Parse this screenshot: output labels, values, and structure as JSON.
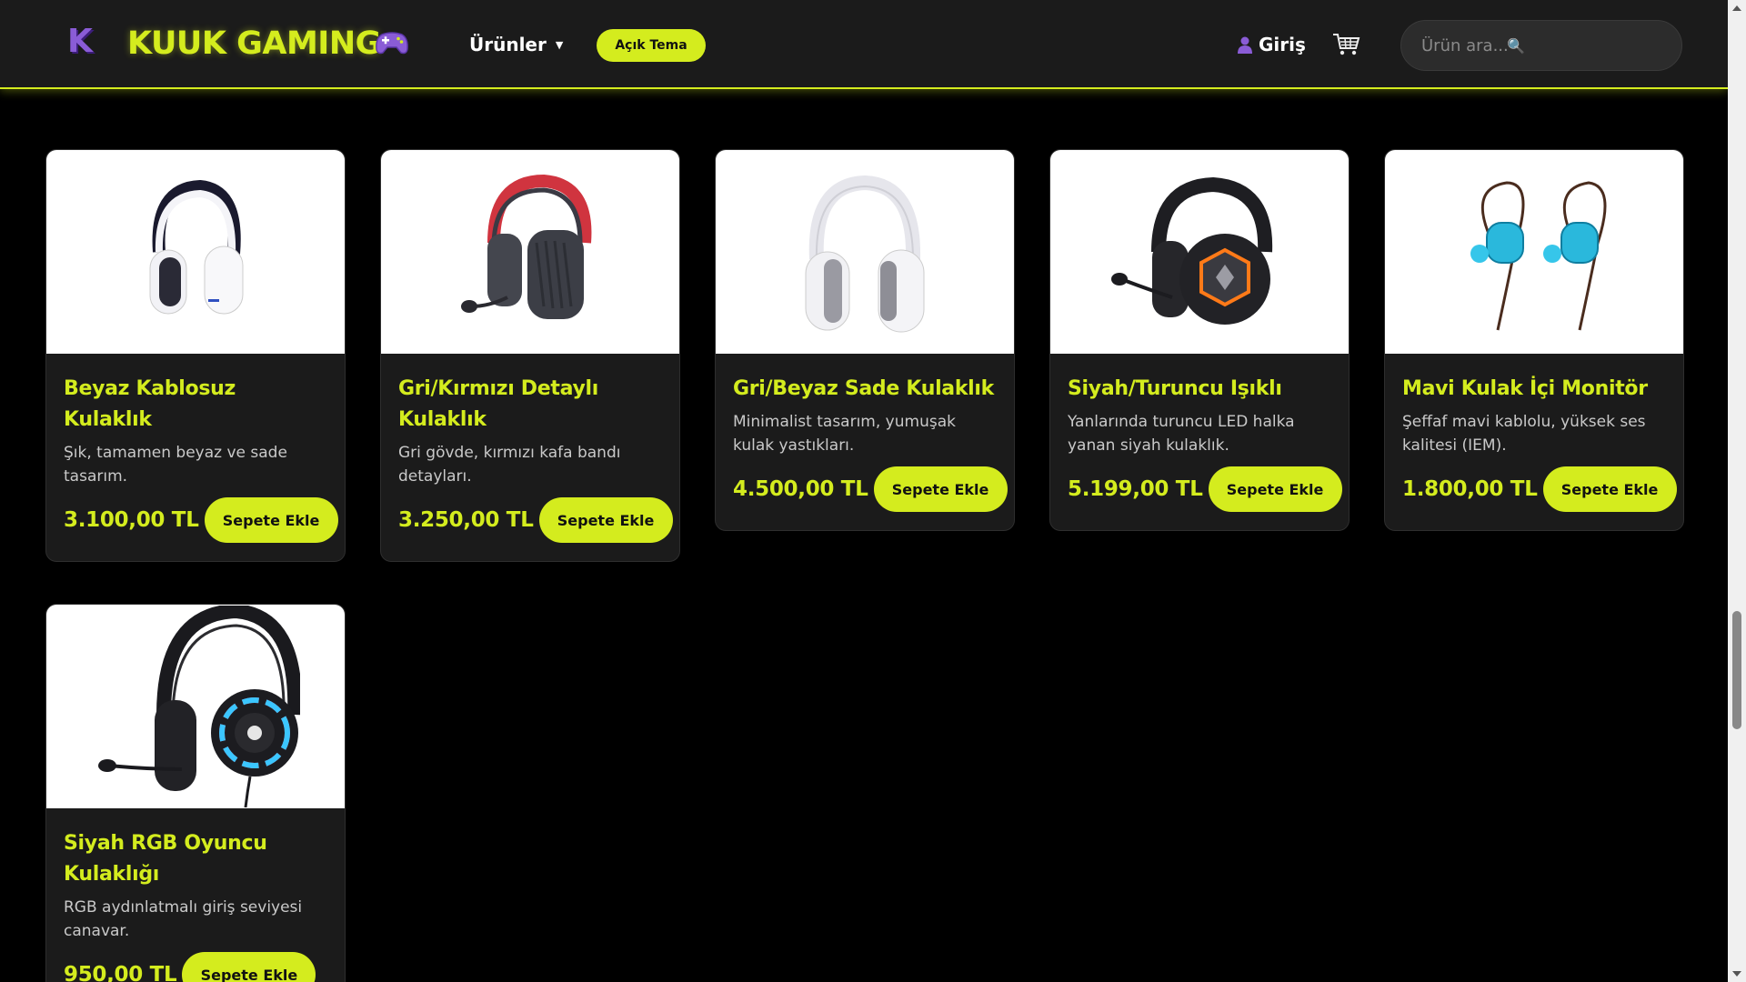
{
  "header": {
    "logo_letter": "K",
    "brand": "KUUK GAMING",
    "brand_icon": "gamepad-icon",
    "products_label": "Ürünler",
    "theme_button": "Açık Tema",
    "login_label": "Giriş",
    "search_placeholder": "Ürün ara...",
    "accent": "#d4ec1e"
  },
  "products": [
    {
      "name": "Beyaz Kablosuz Kulaklık",
      "desc": "Şık, tamamen beyaz ve sade tasarım.",
      "price": "3.100,00 TL",
      "button": "Sepete Ekle"
    },
    {
      "name": "Gri/Kırmızı Detaylı Kulaklık",
      "desc": "Gri gövde, kırmızı kafa bandı detayları.",
      "price": "3.250,00 TL",
      "button": "Sepete Ekle"
    },
    {
      "name": "Gri/Beyaz Sade Kulaklık",
      "desc": "Minimalist tasarım, yumuşak kulak yastıkları.",
      "price": "4.500,00 TL",
      "button": "Sepete Ekle"
    },
    {
      "name": "Siyah/Turuncu Işıklı",
      "desc": "Yanlarında turuncu LED halka yanan siyah kulaklık.",
      "price": "5.199,00 TL",
      "button": "Sepete Ekle"
    },
    {
      "name": "Mavi Kulak İçi Monitör",
      "desc": "Şeffaf mavi kablolu, yüksek ses kalitesi (IEM).",
      "price": "1.800,00 TL",
      "button": "Sepete Ekle"
    },
    {
      "name": "Siyah RGB Oyuncu Kulaklığı",
      "desc": "RGB aydınlatmalı giriş seviyesi canavar.",
      "price": "950,00 TL",
      "button": "Sepete Ekle"
    }
  ]
}
